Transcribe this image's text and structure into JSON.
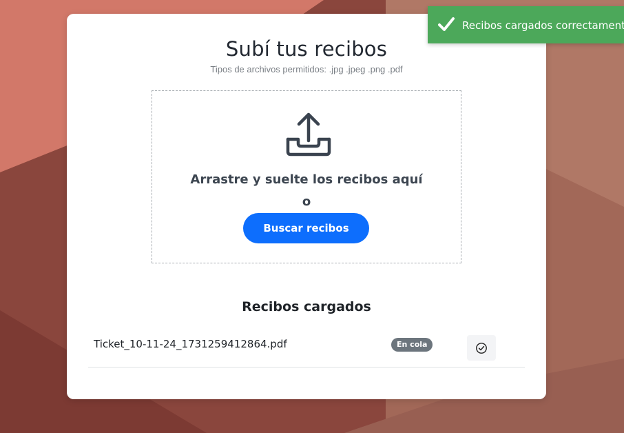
{
  "header": {
    "title": "Subí tus recibos",
    "subtitle": "Tipos de archivos permitidos: .jpg .jpeg .png .pdf"
  },
  "dropzone": {
    "icon": "upload-tray-icon",
    "instruction": "Arrastre y suelte los recibos aquí",
    "or_text": "o",
    "browse_label": "Buscar recibos"
  },
  "uploaded": {
    "title": "Recibos cargados",
    "files": [
      {
        "name": "Ticket_10-11-24_1731259412864.pdf",
        "status": "En cola",
        "action_icon": "check-circle-icon"
      }
    ]
  },
  "toast": {
    "icon": "checkmark-icon",
    "message": "Recibos cargados correctamente"
  },
  "colors": {
    "primary": "#0d6efd",
    "success": "#4ca85a",
    "badge_secondary": "#6c757d"
  }
}
